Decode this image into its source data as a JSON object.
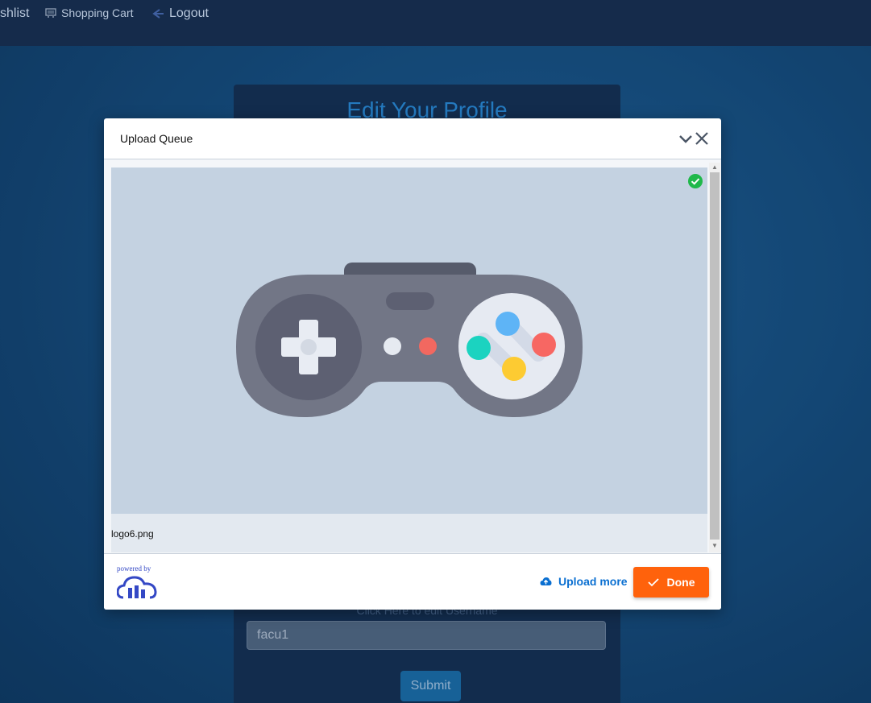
{
  "nav": {
    "wishlist": "shlist",
    "cart": "Shopping Cart",
    "logout": "Logout"
  },
  "profile": {
    "title": "Edit Your Profile",
    "edit_hint": "Click Here to edit Username",
    "username_value": "facu1",
    "submit_label": "Submit"
  },
  "modal": {
    "title": "Upload Queue",
    "file_name": "logo6.png",
    "status": "uploaded",
    "powered_by": "powered by",
    "upload_more_label": "Upload more",
    "done_label": "Done",
    "colors": {
      "accent": "#ff620c",
      "link": "#0a6fd1",
      "success": "#1fb84a"
    }
  }
}
